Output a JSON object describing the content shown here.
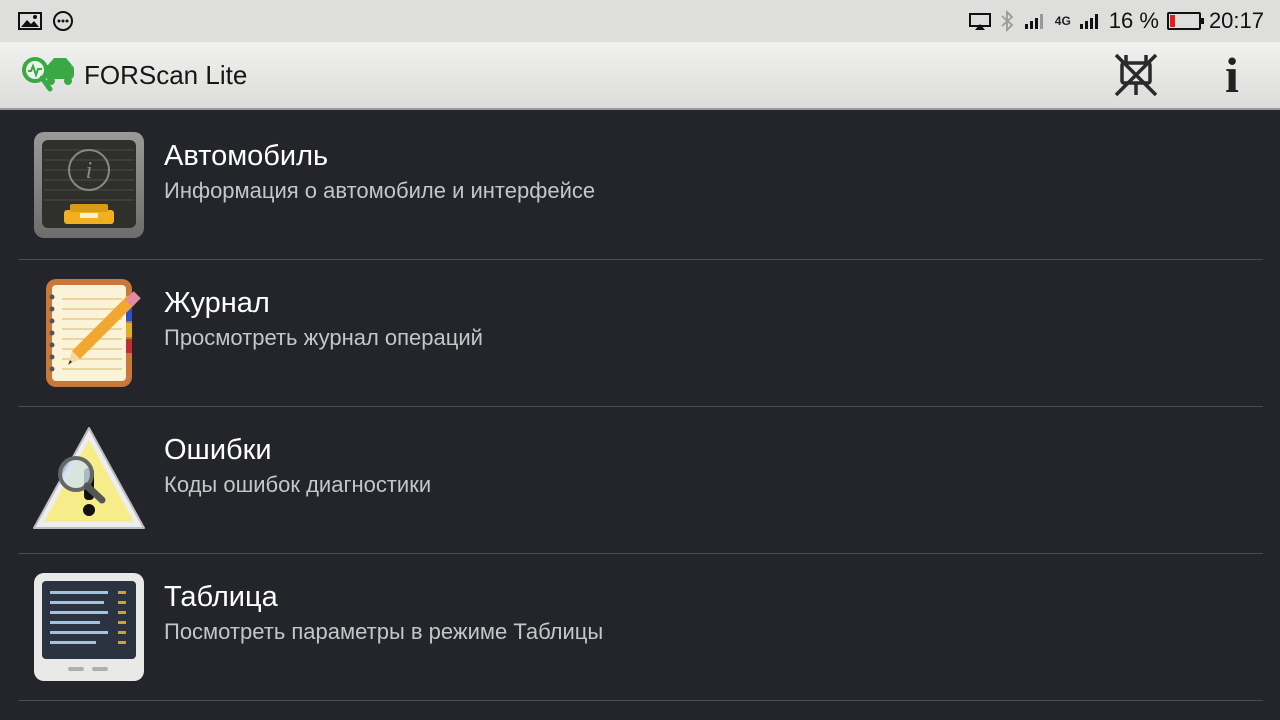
{
  "status_bar": {
    "left_icons": [
      "image-notification-icon",
      "more-notification-icon"
    ],
    "network_label": "4G",
    "battery_text": "16 %",
    "battery_level": 0.16,
    "time": "20:17"
  },
  "app_bar": {
    "title": "FORScan Lite",
    "info_label": "i"
  },
  "menu": {
    "items": [
      {
        "title": "Автомобиль",
        "subtitle": "Информация о автомобиле и интерфейсе",
        "icon": "vehicle-info-icon"
      },
      {
        "title": "Журнал",
        "subtitle": "Просмотреть журнал операций",
        "icon": "notebook-pencil-icon"
      },
      {
        "title": "Ошибки",
        "subtitle": "Коды ошибок диагностики",
        "icon": "warning-magnifier-icon"
      },
      {
        "title": "Таблица",
        "subtitle": "Посмотреть параметры в режиме Таблицы",
        "icon": "monitor-table-icon"
      }
    ]
  },
  "colors": {
    "background": "#23252a",
    "status_bar": "#dedfdd",
    "app_bar": "#e8e8e6",
    "logo_green": "#3aa845",
    "battery_red": "#e02020"
  }
}
